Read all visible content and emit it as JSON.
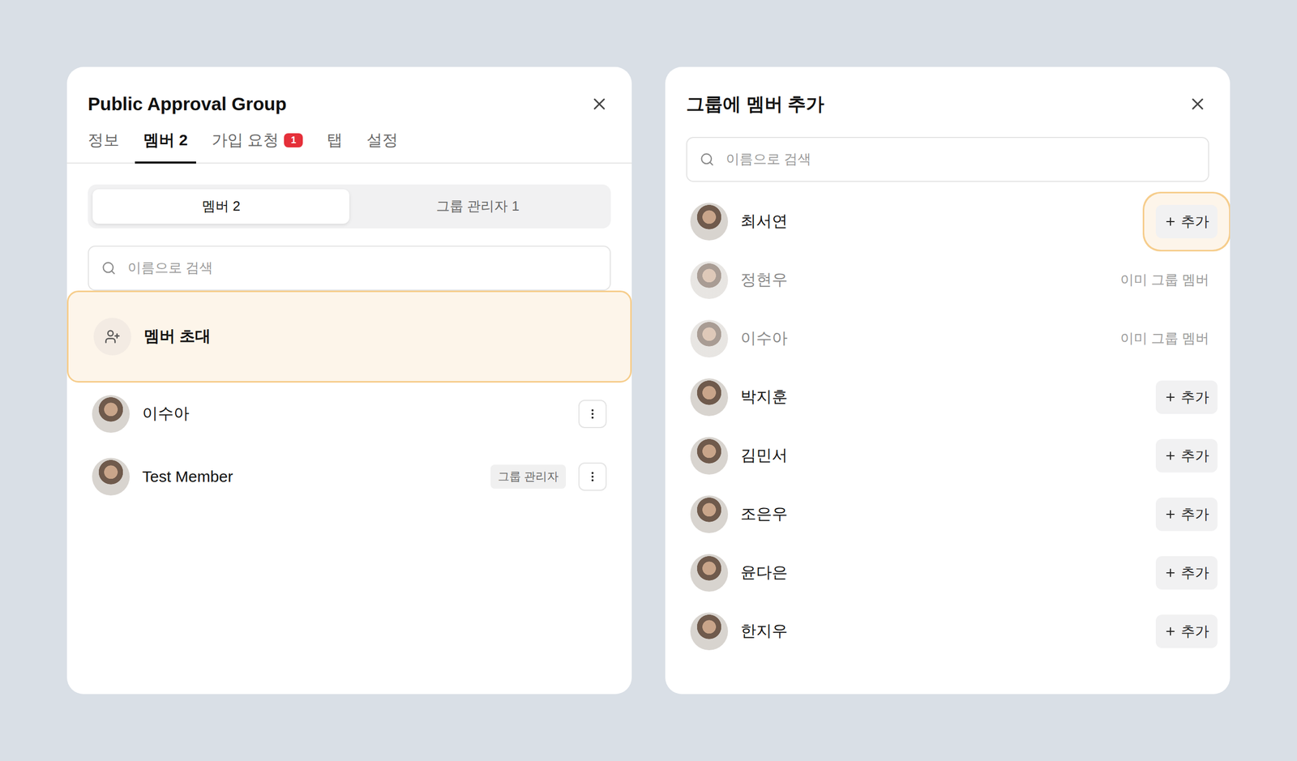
{
  "left": {
    "title": "Public Approval Group",
    "tabs": [
      {
        "label": "정보",
        "selected": false
      },
      {
        "label": "멤버 2",
        "selected": true
      },
      {
        "label": "가입 요청",
        "badge": "1",
        "selected": false
      },
      {
        "label": "탭",
        "selected": false
      },
      {
        "label": "설정",
        "selected": false
      }
    ],
    "segments": [
      {
        "label": "멤버 2",
        "selected": true
      },
      {
        "label": "그룹 관리자 1",
        "selected": false
      }
    ],
    "search": {
      "placeholder": "이름으로 검색"
    },
    "invite": {
      "label": "멤버 초대",
      "highlighted": true
    },
    "members": [
      {
        "name": "이수아"
      },
      {
        "name": "Test Member",
        "badge": "그룹 관리자"
      }
    ]
  },
  "right": {
    "title": "그룹에 멤버 추가",
    "search": {
      "placeholder": "이름으로 검색"
    },
    "people": [
      {
        "name": "최서연",
        "already_member": false,
        "action": "추가",
        "highlighted": true
      },
      {
        "name": "정현우",
        "already_member": true,
        "status": "이미 그룹 멤버",
        "highlighted": false
      },
      {
        "name": "이수아",
        "already_member": true,
        "status": "이미 그룹 멤버",
        "highlighted": false
      },
      {
        "name": "박지훈",
        "already_member": false,
        "action": "추가",
        "highlighted": false
      },
      {
        "name": "김민서",
        "already_member": false,
        "action": "추가",
        "highlighted": false
      },
      {
        "name": "조은우",
        "already_member": false,
        "action": "추가",
        "highlighted": false
      },
      {
        "name": "윤다은",
        "already_member": false,
        "action": "추가",
        "highlighted": false
      },
      {
        "name": "한지우",
        "already_member": false,
        "action": "추가",
        "highlighted": false
      }
    ]
  }
}
